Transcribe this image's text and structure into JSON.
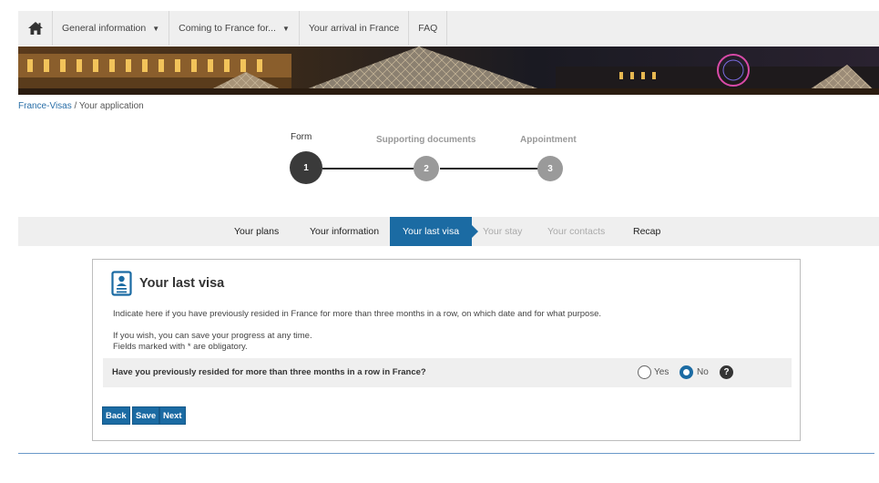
{
  "nav": {
    "items": [
      {
        "label": "General information",
        "dropdown": true
      },
      {
        "label": "Coming to France for...",
        "dropdown": true
      },
      {
        "label": "Your arrival in France",
        "dropdown": false
      },
      {
        "label": "FAQ",
        "dropdown": false
      }
    ],
    "home_icon": "home-icon"
  },
  "breadcrumb": {
    "root": "France-Visas",
    "separator": "/",
    "current": "Your application"
  },
  "stepper": {
    "steps": [
      {
        "label": "Form",
        "number": "1",
        "state": "active"
      },
      {
        "label": "Supporting documents",
        "number": "2",
        "state": "pending"
      },
      {
        "label": "Appointment",
        "number": "3",
        "state": "pending"
      }
    ]
  },
  "tabs": [
    {
      "label": "Your plans",
      "state": "done"
    },
    {
      "label": "Your information",
      "state": "done"
    },
    {
      "label": "Your last visa",
      "state": "active"
    },
    {
      "label": "Your stay",
      "state": "disabled"
    },
    {
      "label": "Your contacts",
      "state": "disabled"
    },
    {
      "label": "Recap",
      "state": "done"
    }
  ],
  "card": {
    "icon": "id-card-icon",
    "title": "Your last visa",
    "intro": "Indicate here if you have previously resided in France for more than three months in a row, on which date and for what purpose.",
    "note_save": "If you wish, you can save your progress at any time.",
    "note_required": "Fields marked with * are obligatory.",
    "question": "Have you previously resided for more than three months in a row in France?",
    "options": {
      "yes": "Yes",
      "no": "No"
    },
    "selected": "No",
    "help_icon": "question-circle-icon",
    "buttons": {
      "back": "Back",
      "save": "Save",
      "next": "Next"
    }
  },
  "colors": {
    "primary": "#1b6ba3",
    "step_active": "#3a3a3a",
    "step_pending": "#9a9a9a",
    "nav_bg": "#efefef"
  }
}
